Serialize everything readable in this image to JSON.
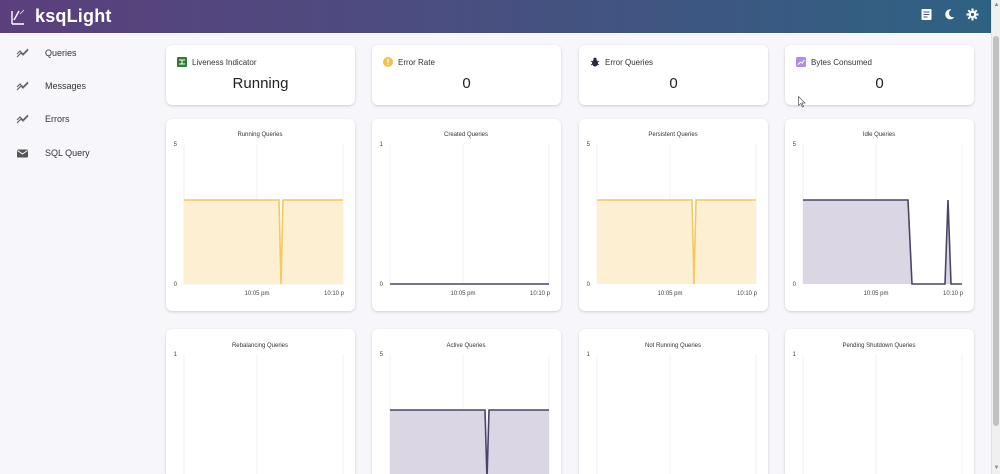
{
  "app": {
    "title": "ksqLight"
  },
  "topbar": {
    "icons": [
      "document-icon",
      "moon-icon",
      "gear-icon"
    ]
  },
  "sidebar": {
    "items": [
      {
        "label": "Queries",
        "icon": "trend-icon"
      },
      {
        "label": "Messages",
        "icon": "trend-icon"
      },
      {
        "label": "Errors",
        "icon": "trend-icon"
      },
      {
        "label": "SQL Query",
        "icon": "mail-icon"
      }
    ]
  },
  "stats": [
    {
      "label": "Liveness Indicator",
      "value": "Running",
      "icon": "network-icon",
      "color": "#2e7d32"
    },
    {
      "label": "Error Rate",
      "value": "0",
      "icon": "warning-icon",
      "color": "#f2c14e"
    },
    {
      "label": "Error Queries",
      "value": "0",
      "icon": "bug-icon",
      "color": "#2d2a3e"
    },
    {
      "label": "Bytes Consumed",
      "value": "0",
      "icon": "chart-icon",
      "color": "#b48be8"
    }
  ],
  "colors": {
    "yellow_line": "#f4c95d",
    "yellow_fill": "#fcefd2",
    "purple_line": "#4b4468",
    "purple_fill": "#dad6e3"
  },
  "charts": [
    {
      "title": "Running Queries",
      "y_labels": [
        "5",
        "0"
      ],
      "x_labels": [
        "10:05 pm",
        "10:10 p"
      ]
    },
    {
      "title": "Created Queries",
      "y_labels": [
        "1",
        "0"
      ],
      "x_labels": [
        "10:05 pm",
        "10:10 p"
      ]
    },
    {
      "title": "Persistent Queries",
      "y_labels": [
        "5",
        "0"
      ],
      "x_labels": [
        "10:05 pm",
        "10:10 p"
      ]
    },
    {
      "title": "Idle Queries",
      "y_labels": [
        "5",
        "0"
      ],
      "x_labels": [
        "10:05 pm",
        "10:10 p"
      ]
    },
    {
      "title": "Rebalancing Queries",
      "y_labels": [
        "1"
      ],
      "x_labels": []
    },
    {
      "title": "Active Queries",
      "y_labels": [
        "5"
      ],
      "x_labels": []
    },
    {
      "title": "Not Running Queries",
      "y_labels": [
        "1"
      ],
      "x_labels": []
    },
    {
      "title": "Pending Shutdown Queries",
      "y_labels": [
        "1"
      ],
      "x_labels": []
    }
  ]
}
